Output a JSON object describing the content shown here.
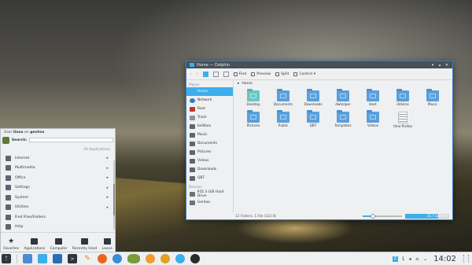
{
  "dolphin": {
    "title": "Home — Dolphin",
    "toolbar": {
      "back": "‹",
      "forward": "›",
      "find": "Find",
      "preview": "Preview",
      "split": "Split",
      "control": "Control"
    },
    "places_title": "Places",
    "places": [
      {
        "label": "Home",
        "icon": "home-icon"
      },
      {
        "label": "Network",
        "icon": "network-icon"
      },
      {
        "label": "Root",
        "icon": "root-icon"
      },
      {
        "label": "Trash",
        "icon": "trash-icon"
      },
      {
        "label": "bellibox",
        "icon": "folder-icon"
      },
      {
        "label": "Music",
        "icon": "music-icon"
      },
      {
        "label": "Documents",
        "icon": "documents-icon"
      },
      {
        "label": "Pictures",
        "icon": "pictures-icon"
      },
      {
        "label": "Videos",
        "icon": "videos-icon"
      },
      {
        "label": "Downloads",
        "icon": "downloads-icon"
      },
      {
        "label": "QBT",
        "icon": "folder-icon"
      }
    ],
    "devices_title": "Devices",
    "devices": [
      {
        "label": "935.3 GiB Hard Drive",
        "icon": "hard-drive-icon"
      },
      {
        "label": "Gentoo",
        "icon": "hard-drive-icon"
      }
    ],
    "breadcrumb": "Home",
    "files": [
      {
        "label": "Desktop",
        "kind": "folder-desktop"
      },
      {
        "label": "Documents",
        "kind": "folder"
      },
      {
        "label": "Downloads",
        "kind": "folder"
      },
      {
        "label": "dwhelper",
        "kind": "folder"
      },
      {
        "label": "Host",
        "kind": "folder"
      },
      {
        "label": "iAdvIne",
        "kind": "folder"
      },
      {
        "label": "Music",
        "kind": "folder"
      },
      {
        "label": "Pictures",
        "kind": "folder"
      },
      {
        "label": "Public",
        "kind": "folder"
      },
      {
        "label": "QBT",
        "kind": "folder"
      },
      {
        "label": "Templates",
        "kind": "folder"
      },
      {
        "label": "Videos",
        "kind": "folder"
      },
      {
        "label": "time firefox",
        "kind": "document"
      }
    ],
    "status": "12 Folders, 1 File (322 B)",
    "zoom_level": 0.25,
    "free_space_fill": 0.75,
    "free_space_text": "33.7 GiB free"
  },
  "kickoff": {
    "user_prefix": "User ",
    "user_name": "linux",
    "user_mid": " on ",
    "host": "gentoo",
    "search_label": "Search:",
    "all_apps": "All Applications",
    "categories": [
      {
        "label": "Internet",
        "arrow": true
      },
      {
        "label": "Multimedia",
        "arrow": true
      },
      {
        "label": "Office",
        "arrow": true
      },
      {
        "label": "Settings",
        "arrow": true
      },
      {
        "label": "System",
        "arrow": true
      },
      {
        "label": "Utilities",
        "arrow": true
      },
      {
        "label": "Find Files/Folders",
        "arrow": false
      },
      {
        "label": "Help",
        "arrow": false
      }
    ],
    "tabs": [
      {
        "label": "Favorites",
        "icon": "star-icon"
      },
      {
        "label": "Applications",
        "icon": "applications-icon"
      },
      {
        "label": "Computer",
        "icon": "computer-icon"
      },
      {
        "label": "Recently Used",
        "icon": "clock-icon"
      },
      {
        "label": "Leave",
        "icon": "leave-icon"
      }
    ]
  },
  "taskbar": {
    "clock": "14:02",
    "tray_labels": [
      "1",
      "◂",
      "ㅇ",
      "⌄"
    ],
    "tray_badge": "2"
  },
  "colors": {
    "accent": "#3daee9",
    "window_bg": "#eff0f1",
    "text": "#31363b"
  }
}
